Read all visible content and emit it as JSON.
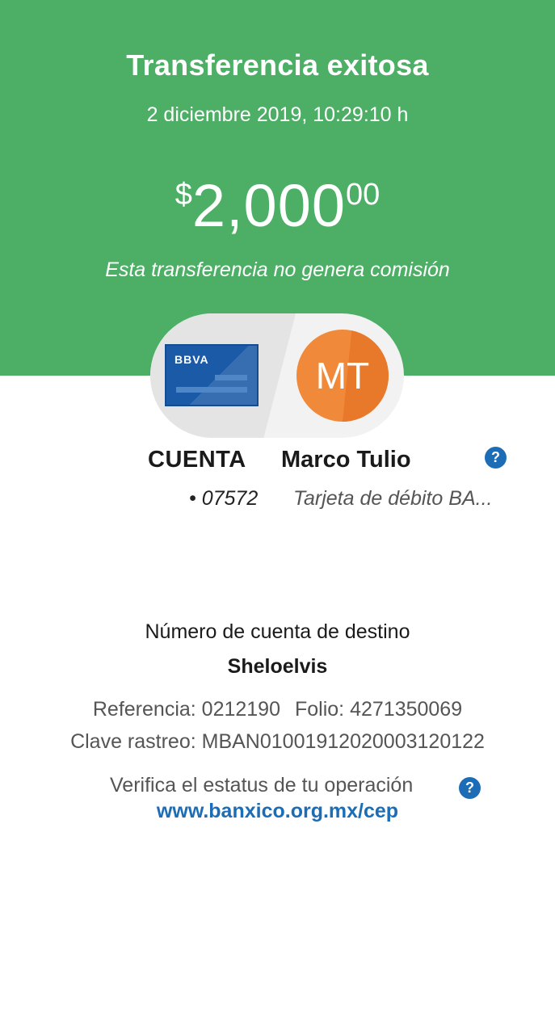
{
  "header": {
    "title": "Transferencia exitosa",
    "datetime": "2 diciembre 2019, 10:29:10 h",
    "amount": {
      "currency": "$",
      "integer": "2,000",
      "decimals": "00"
    },
    "note": "Esta transferencia no genera comisión",
    "background_color": "#4caf65"
  },
  "origin": {
    "card_brand": "BBVA",
    "label": "CUENTA",
    "account": "• 07572"
  },
  "payee": {
    "initials": "MT",
    "name": "Marco Tulio",
    "subtitle": "Tarjeta de débito BA...",
    "avatar_color": "#f08a3a"
  },
  "details": {
    "dest_label": "Número de cuenta de destino",
    "dest_value": "Sheloelvis",
    "reference": "Referencia: 0212190",
    "folio": "Folio: 4271350069",
    "clave": "Clave rastreo: MBAN01001912020003120122",
    "verify_text": "Verifica el estatus de tu operación",
    "verify_link": "www.banxico.org.mx/cep"
  },
  "icons": {
    "help": "?"
  },
  "colors": {
    "link": "#1c6db5",
    "help": "#1c6db5"
  }
}
